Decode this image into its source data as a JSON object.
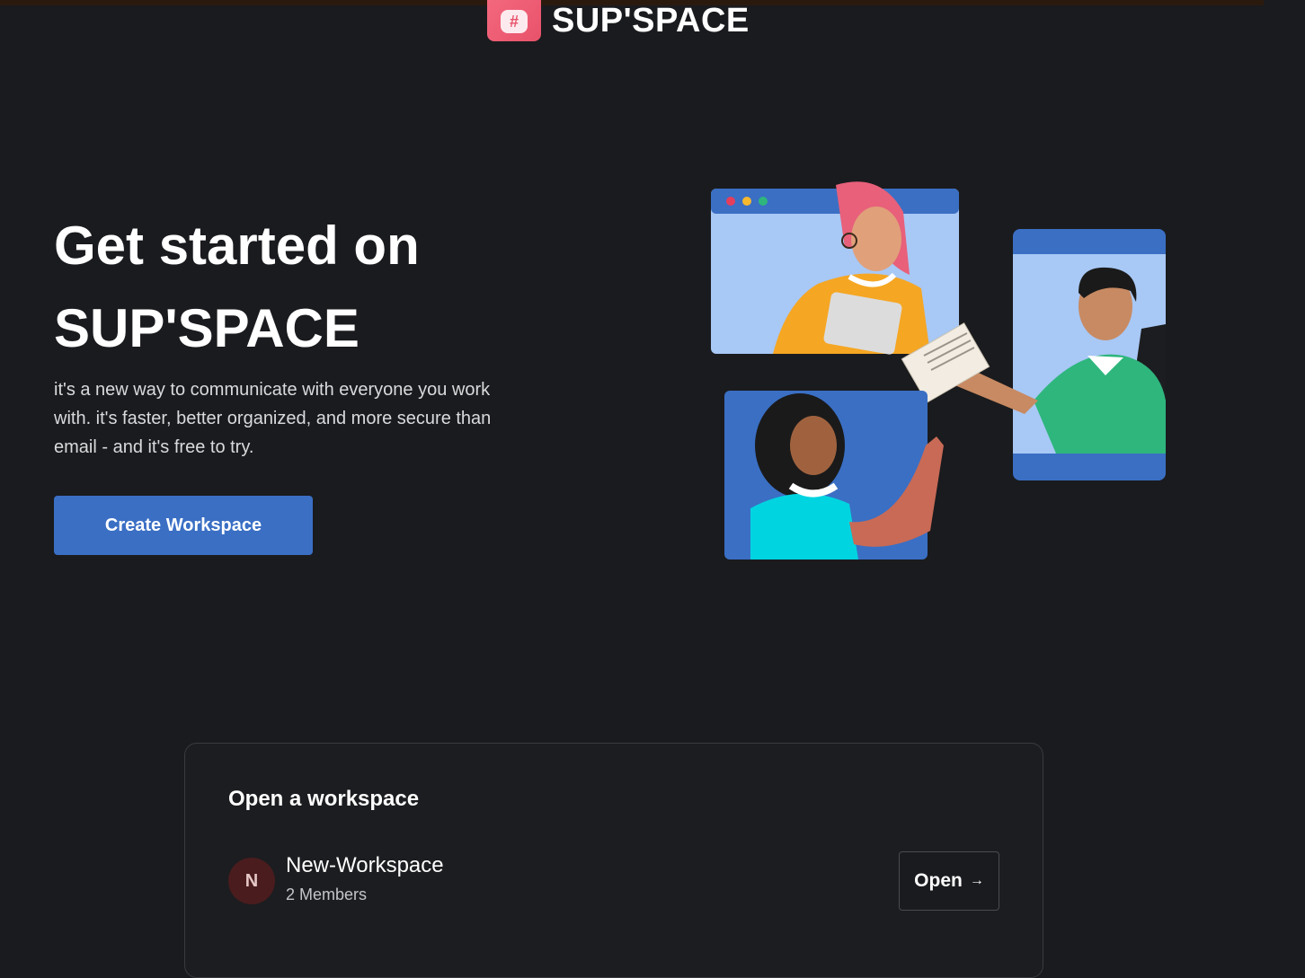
{
  "brand": {
    "name": "SUP'SPACE",
    "logo_icon": "hash-chat-icon"
  },
  "hero": {
    "title_line1": "Get started on",
    "title_line2": "SUP'SPACE",
    "description": "it's a new way to communicate with everyone you work with. it's faster, better organized, and more secure than email - and it's free to try.",
    "cta_label": "Create Workspace"
  },
  "workspaces": {
    "heading": "Open a workspace",
    "items": [
      {
        "initial": "N",
        "name": "New-Workspace",
        "members": "2 Members",
        "open_label": "Open",
        "open_icon": "arrow-right-icon"
      }
    ]
  },
  "colors": {
    "background": "#1a1b1e",
    "accent": "#3a6fc4",
    "brand": "#e8526b"
  }
}
